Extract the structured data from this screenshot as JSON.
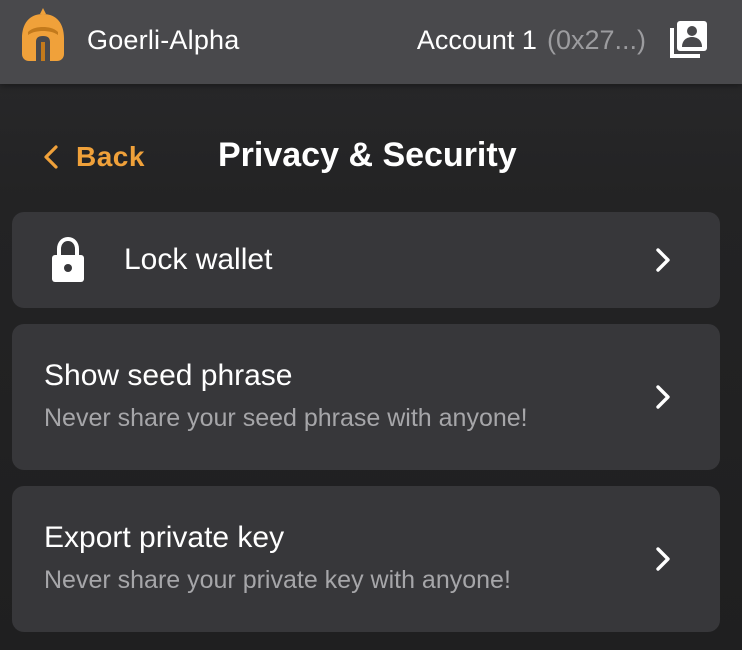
{
  "header": {
    "network": "Goerli-Alpha",
    "account_name": "Account 1",
    "account_address": "(0x27...)",
    "logo_icon": "helmet-logo-icon",
    "accounts_icon": "accounts-list-icon"
  },
  "nav": {
    "back_label": "Back",
    "title": "Privacy & Security"
  },
  "menu": {
    "items": [
      {
        "label": "Lock wallet",
        "icon": "lock-icon"
      },
      {
        "label": "Show seed phrase",
        "description": "Never share your seed phrase with anyone!"
      },
      {
        "label": "Export private key",
        "description": "Never share your private key with anyone!"
      }
    ]
  },
  "colors": {
    "accent": "#f0a13a",
    "header_bg": "#49494c",
    "card_bg": "#37373a",
    "muted_text": "#a6a6a9"
  }
}
